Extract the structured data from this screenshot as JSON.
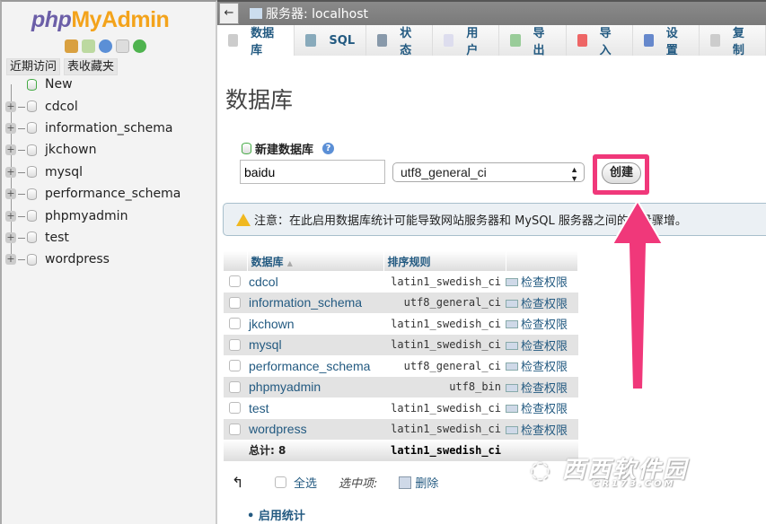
{
  "logo": {
    "php": "php",
    "myadmin": "MyAdmin"
  },
  "nav": {
    "tabs": [
      "近期访问",
      "表收藏夹"
    ],
    "new_label": "New",
    "databases": [
      "cdcol",
      "information_schema",
      "jkchown",
      "mysql",
      "performance_schema",
      "phpmyadmin",
      "test",
      "wordpress"
    ]
  },
  "topbar": {
    "back": "←",
    "server": "服务器: localhost"
  },
  "tabs": [
    {
      "label": "数据库",
      "icon": "database-icon"
    },
    {
      "label": "SQL",
      "icon": "sql-icon"
    },
    {
      "label": "状态",
      "icon": "status-icon"
    },
    {
      "label": "用户",
      "icon": "users-icon"
    },
    {
      "label": "导出",
      "icon": "export-icon"
    },
    {
      "label": "导入",
      "icon": "import-icon"
    },
    {
      "label": "设置",
      "icon": "settings-icon"
    },
    {
      "label": "复制",
      "icon": "replication-icon"
    }
  ],
  "main": {
    "title": "数据库",
    "new_db_label": "新建数据库",
    "db_name_value": "baidu",
    "collation_value": "utf8_general_ci",
    "create_button": "创建",
    "notice": "注意：在此启用数据库统计可能导致网站服务器和 MySQL 服务器之间的流量骤增。",
    "table": {
      "headers": [
        "数据库",
        "排序规则"
      ],
      "sort_indicator": "▲",
      "rows": [
        {
          "name": "cdcol",
          "collation": "latin1_swedish_ci",
          "action": "检查权限"
        },
        {
          "name": "information_schema",
          "collation": "utf8_general_ci",
          "action": "检查权限"
        },
        {
          "name": "jkchown",
          "collation": "latin1_swedish_ci",
          "action": "检查权限"
        },
        {
          "name": "mysql",
          "collation": "latin1_swedish_ci",
          "action": "检查权限"
        },
        {
          "name": "performance_schema",
          "collation": "utf8_general_ci",
          "action": "检查权限"
        },
        {
          "name": "phpmyadmin",
          "collation": "utf8_bin",
          "action": "检查权限"
        },
        {
          "name": "test",
          "collation": "latin1_swedish_ci",
          "action": "检查权限"
        },
        {
          "name": "wordpress",
          "collation": "latin1_swedish_ci",
          "action": "检查权限"
        }
      ],
      "total_label": "总计: 8",
      "total_collation": "latin1_swedish_ci"
    },
    "select_all": "全选",
    "with_selected": "选中项:",
    "drop": "删除",
    "enable_stats": "启用统计"
  },
  "highlight_color": "#f0387a",
  "watermark": {
    "text": "西西软件园",
    "url": "CR173.COM"
  }
}
